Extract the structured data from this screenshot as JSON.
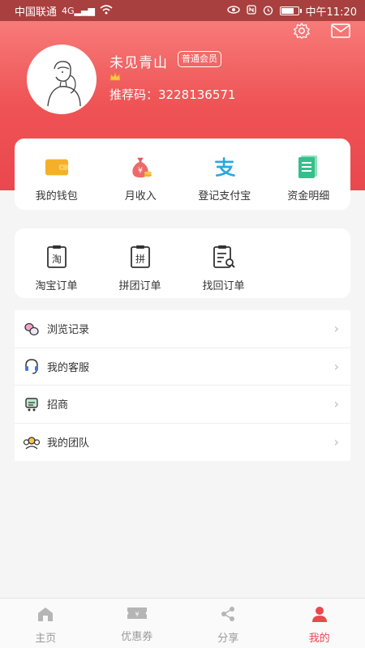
{
  "status_bar": {
    "carrier": "中国联通",
    "signal": "4G",
    "time": "中午11:20"
  },
  "profile": {
    "username": "未见青山",
    "member_badge": "普通会员",
    "referral_label": "推荐码：",
    "referral_code": "3228136571"
  },
  "quick_actions": [
    {
      "label": "我的钱包",
      "icon": "wallet-icon",
      "color": "#f5b02a"
    },
    {
      "label": "月收入",
      "icon": "money-bag-icon",
      "color": "#ee6a6a"
    },
    {
      "label": "登记支付宝",
      "icon": "alipay-icon",
      "color": "#2aa6e0"
    },
    {
      "label": "资金明细",
      "icon": "list-doc-icon",
      "color": "#34c08b"
    }
  ],
  "order_actions": [
    {
      "label": "淘宝订单",
      "icon": "taobao-order-icon",
      "glyph": "淘"
    },
    {
      "label": "拼团订单",
      "icon": "group-order-icon",
      "glyph": "拼"
    },
    {
      "label": "找回订单",
      "icon": "find-order-icon",
      "glyph": ""
    }
  ],
  "menu": [
    {
      "label": "浏览记录",
      "icon": "footprint-icon"
    },
    {
      "label": "我的客服",
      "icon": "headset-icon"
    },
    {
      "label": "招商",
      "icon": "merchant-icon"
    },
    {
      "label": "我的团队",
      "icon": "team-icon"
    }
  ],
  "tabs": [
    {
      "label": "主页",
      "icon": "home-icon",
      "active": false
    },
    {
      "label": "优惠券",
      "icon": "coupon-icon",
      "active": false
    },
    {
      "label": "分享",
      "icon": "share-icon",
      "active": false
    },
    {
      "label": "我的",
      "icon": "profile-icon",
      "active": true
    }
  ],
  "colors": {
    "accent": "#e9484e",
    "header": "#ef5355",
    "status_bar": "#a8403f"
  }
}
